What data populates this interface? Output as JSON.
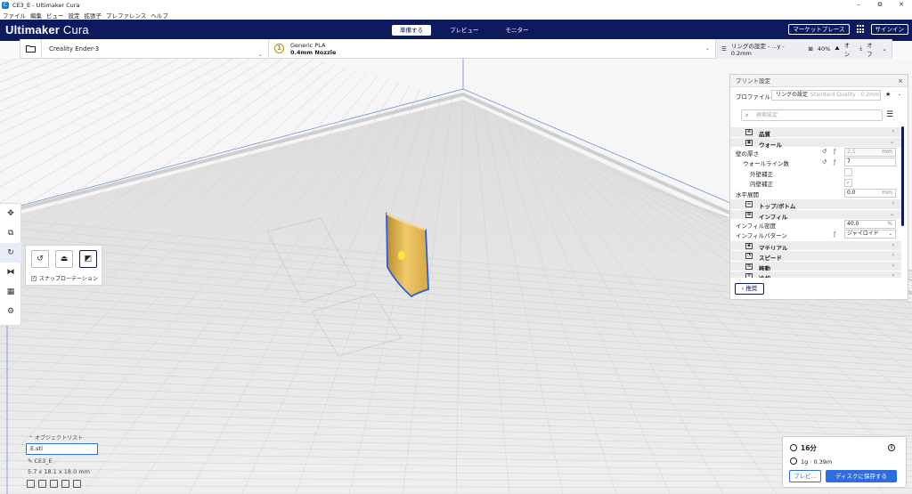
{
  "window": {
    "title": "CE3_E - Ultimaker Cura",
    "icon_label": "C",
    "controls": [
      "–",
      "⧉",
      "✕"
    ]
  },
  "menu": [
    "ファイル",
    "編集",
    "ビュー",
    "設定",
    "拡張子",
    "プレファレンス",
    "ヘルプ"
  ],
  "header": {
    "brand_bold": "Ultimaker",
    "brand_light": "Cura",
    "tabs": [
      "準備する",
      "プレビュー",
      "モニター"
    ],
    "active_tab": 0,
    "marketplace": "マーケットプレース",
    "signin": "サインイン"
  },
  "printer_bar": {
    "printer": "Creality Ender-3",
    "material_name": "Generic PLA",
    "nozzle": "0.4mm Nozzle",
    "material_icon": "1",
    "settings_summary": "リングの設定 - ...y - 0.2mm",
    "infill": "40%",
    "support": "オン",
    "adhesion": "オフ"
  },
  "toolbar": {
    "tools": [
      "move-icon",
      "scale-icon",
      "rotate-icon",
      "mirror-icon",
      "per-model-settings-icon",
      "support-blocker-icon"
    ],
    "selected": 2
  },
  "rotate_popup": {
    "snap_label": "スナップローテーション",
    "snap_checked": true
  },
  "panel": {
    "title": "プリント設定",
    "profile_label": "プロファイル",
    "profile_value": "リングの設定",
    "profile_hint": "Standard Quality - 0.2mm",
    "search_placeholder": "検索設定",
    "back_label": "推奨",
    "rows": [
      {
        "kind": "cat",
        "label": "品質",
        "icon": "quality-icon",
        "glyph": "≡",
        "chev": "‹"
      },
      {
        "kind": "cat",
        "label": "ウォール",
        "icon": "wall-icon",
        "glyph": "▣",
        "chev": "⌄"
      },
      {
        "kind": "setting",
        "label": "壁の厚さ",
        "indent": 0,
        "value": "2.5",
        "unit": "mm",
        "disabled": true,
        "reset": true,
        "fx": true
      },
      {
        "kind": "setting",
        "label": "ウォールライン数",
        "indent": 1,
        "value": "7",
        "unit": "",
        "disabled": false,
        "reset": true,
        "fx": true
      },
      {
        "kind": "check",
        "label": "外壁補正",
        "indent": 2,
        "checked": false
      },
      {
        "kind": "check",
        "label": "内壁補正",
        "indent": 2,
        "checked": true
      },
      {
        "kind": "setting",
        "label": "水平展開",
        "indent": 0,
        "value": "0.0",
        "unit": "mm",
        "disabled": false,
        "reset": false,
        "fx": false
      },
      {
        "kind": "cat",
        "label": "トップ/ボトム",
        "icon": "top-bottom-icon",
        "glyph": "☰",
        "chev": "‹"
      },
      {
        "kind": "cat",
        "label": "インフィル",
        "icon": "infill-icon",
        "glyph": "⊠",
        "chev": "⌄"
      },
      {
        "kind": "setting",
        "label": "インフィル密度",
        "indent": 0,
        "value": "40.0",
        "unit": "%",
        "disabled": false,
        "reset": false,
        "fx": false
      },
      {
        "kind": "select",
        "label": "インフィルパターン",
        "indent": 0,
        "value": "ジャイロイド",
        "fx": true
      },
      {
        "kind": "cat",
        "label": "マテリアル",
        "icon": "material-icon",
        "glyph": "◉",
        "chev": "‹"
      },
      {
        "kind": "cat",
        "label": "スピード",
        "icon": "speed-icon",
        "glyph": "◔",
        "chev": "‹"
      },
      {
        "kind": "cat",
        "label": "移動",
        "icon": "travel-icon",
        "glyph": "⇆",
        "chev": "‹"
      },
      {
        "kind": "cat",
        "label": "冷却",
        "icon": "cooling-icon",
        "glyph": "✲",
        "chev": "‹"
      }
    ]
  },
  "object_list": {
    "title": "オブジェクトリスト",
    "file": "E.stl",
    "job_name": "CE3_E",
    "dimensions": "5.7 x 18.1 x 18.0 mm"
  },
  "estimate": {
    "time": "16分",
    "material": "1g · 0.39m",
    "preview_btn": "プレビ...",
    "save_btn": "ディスクに保存する"
  }
}
